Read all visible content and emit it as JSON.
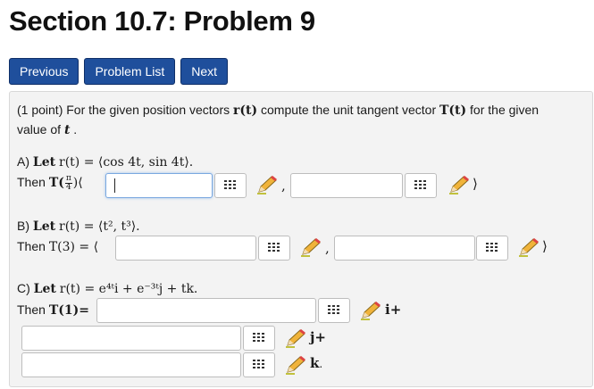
{
  "page": {
    "title": "Section 10.7: Problem 9"
  },
  "nav": {
    "previous": "Previous",
    "problem_list": "Problem List",
    "next": "Next"
  },
  "problem": {
    "points": "(1 point)",
    "intro_a": "For the given position vectors",
    "r_t": "r(t)",
    "intro_b": "compute the unit tangent vector",
    "T_t": "T(t)",
    "intro_c": "for the given",
    "intro_d": "value of",
    "t": "t",
    "period": "."
  },
  "part_a": {
    "label": "A)",
    "let": "Let",
    "r": "r(t) = ⟨cos 4t, sin 4t⟩.",
    "then": "Then",
    "T_prefix": "T(",
    "frac_num": "π",
    "frac_den": "4",
    "T_suffix": ")⟨",
    "comma": ",",
    "close": "⟩"
  },
  "part_b": {
    "label": "B)",
    "let": "Let",
    "r": "r(t) = ⟨t², t³⟩.",
    "then": "Then",
    "T": "T(3) = ⟨",
    "comma": ",",
    "close": "⟩"
  },
  "part_c": {
    "label": "C)",
    "let": "Let",
    "r": "r(t) = e⁴ᵗi + e⁻³ᵗj + tk.",
    "then": "Then",
    "T": "T(1)=",
    "i": "i+",
    "j": "j+",
    "k": "k",
    "k_period": "."
  },
  "inputs": {
    "a1": "",
    "a2": "",
    "b1": "",
    "b2": "",
    "c1": "",
    "c2": "",
    "c3": ""
  },
  "colors": {
    "nav_button": "#1f4f9c",
    "panel": "#f3f3f3",
    "focus_border": "#7aa8e0"
  },
  "icons": {
    "grid": "equation-editor-grid-icon",
    "pencil": "pencil-icon"
  }
}
